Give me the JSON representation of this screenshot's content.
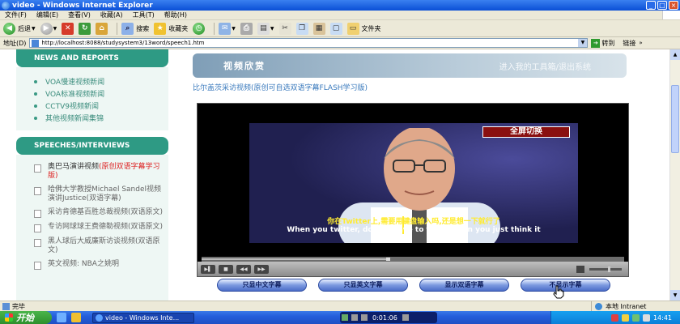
{
  "window": {
    "title": "video - Windows Internet Explorer"
  },
  "menu": [
    "文件(F)",
    "编辑(E)",
    "查看(V)",
    "收藏(A)",
    "工具(T)",
    "帮助(H)"
  ],
  "toolbar": {
    "back": "后退",
    "search": "搜索",
    "favorites": "收藏夹",
    "folders": "文件夹"
  },
  "address": {
    "label": "地址(D)",
    "url": "http://localhost:8088/studysystem3/13word/speech1.htm",
    "go": "转到",
    "links": "链接"
  },
  "sidebar": {
    "news_heading": "NEWS AND REPORTS",
    "news": [
      "VOA慢速视频新闻",
      "VOA标准视频新闻",
      "CCTV9视频新闻",
      "其他视频新闻集锦"
    ],
    "speech_heading": "SPEECHES/INTERVIEWS",
    "speeches": [
      {
        "text": "奥巴马演讲视频",
        "tag": "(原创双语字幕学习版)"
      },
      {
        "text": "哈佛大学教授Michael Sandel视频演讲Justice(双语字幕)",
        "tag": ""
      },
      {
        "text": "采访肯德基百胜总裁视频(双语原文)",
        "tag": ""
      },
      {
        "text": "专访网球球王费德勒视频(双语原文)",
        "tag": ""
      },
      {
        "text": "黑人球后大威廉斯访谈视频(双语原文)",
        "tag": ""
      },
      {
        "text": "英文视频: NBA之姚明",
        "tag": ""
      }
    ]
  },
  "main": {
    "banner_title": "视频欣赏",
    "banner_link": "进入我的工具箱/退出系统",
    "subtitle": "比尔盖茨采访视频(原创可自选双语字幕FLASH学习版)",
    "fullscreen": "全屏切换",
    "caption_cn": "你在Twitter上,需要用键盘输入吗,还是想一下就行了",
    "caption_en": "When you twitter, do you have to type or can you just think it",
    "progress": 0.44,
    "volume": 0.6,
    "sub_buttons": [
      "只显中文字幕",
      "只显英文字幕",
      "显示双语字幕",
      "不显示字幕"
    ]
  },
  "status": {
    "done": "完毕",
    "zone": "本地 Intranet"
  },
  "taskbar": {
    "start": "开始",
    "task": "video - Windows Inte...",
    "media_time": "0:01:06",
    "clock": "14:41"
  },
  "colors": {
    "sidebar_heading": "#2e9a84",
    "sidebar_link": "#3a8c7c",
    "subtitle": "#3a7abd",
    "caption_cn": "#ffeb30",
    "tag_red": "#dd2222"
  }
}
